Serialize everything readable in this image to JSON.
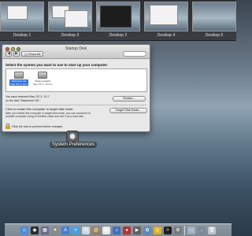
{
  "spaces": [
    {
      "label": "Desktop 1"
    },
    {
      "label": "Desktop 3"
    },
    {
      "label": "Desktop 2"
    },
    {
      "label": "Desktop 4"
    },
    {
      "label": "Desktop 5"
    }
  ],
  "window": {
    "title": "Startup Disk",
    "nav_back": "◀",
    "nav_forward": "▶",
    "show_all_label": "Show All",
    "prompt": "Select the system you want to use to start up your computer",
    "disks": [
      {
        "name": "Macintosh HD",
        "os": "Mac OS X, 10.7",
        "selected": true
      },
      {
        "name": "Snow Leopard",
        "os": "Mac OS X, 10.6.8",
        "selected": false
      }
    ],
    "status_line1": "You have selected Mac OS X, 10.7",
    "status_line2": "on the disk \"Macintosh HD.\"",
    "restart_label": "Restart...",
    "tdm_title": "Click to restart this computer in target disk mode",
    "tdm_desc": "After you restart this computer in target disk mode, you can connect it to another computer using a FireWire cable and use it as a hard disk.",
    "tdm_button_label": "Target Disk Mode...",
    "lock_text": "Click the lock to prevent further changes."
  },
  "app_label": "System Preferences",
  "dock": {
    "items": [
      {
        "icon": "finder-icon",
        "color": "#4a8de0",
        "glyph": "☺"
      },
      {
        "icon": "dashboard-icon",
        "color": "#2a2a2a",
        "glyph": "◉"
      },
      {
        "icon": "mission-control-icon",
        "color": "#6a6a8a",
        "glyph": "▦"
      },
      {
        "icon": "launchpad-icon",
        "color": "#8a8a8a",
        "glyph": "✦"
      },
      {
        "icon": "app-store-icon",
        "color": "#3d82d8",
        "glyph": "A"
      },
      {
        "icon": "safari-icon",
        "color": "#4aa0e8",
        "glyph": "✧"
      },
      {
        "icon": "mail-icon",
        "color": "#cfd6df",
        "glyph": "✉"
      },
      {
        "icon": "contacts-icon",
        "color": "#a08050",
        "glyph": "@"
      },
      {
        "icon": "ical-icon",
        "color": "#e8e8e8",
        "glyph": "▤"
      },
      {
        "icon": "itunes-icon",
        "color": "#3a6fc0",
        "glyph": "♫"
      },
      {
        "icon": "photo-booth-icon",
        "color": "#b83030",
        "glyph": "●"
      },
      {
        "icon": "facetime-icon",
        "color": "#606060",
        "glyph": "▶"
      },
      {
        "icon": "iphoto-icon",
        "color": "#5a8ab8",
        "glyph": "✿"
      },
      {
        "icon": "chrome-icon",
        "color": "#e0b020",
        "glyph": "◎"
      },
      {
        "icon": "terminal-icon",
        "color": "#202020",
        "glyph": ">"
      },
      {
        "icon": "system-preferences-icon",
        "color": "#7a7a7a",
        "glyph": "⚙"
      },
      {
        "icon": "finder-window-icon",
        "color": "#a0b0c0",
        "glyph": "▭"
      },
      {
        "icon": "downloads-icon",
        "color": "#7a8a9a",
        "glyph": "↓"
      },
      {
        "icon": "trash-icon",
        "color": "#c0c4c8",
        "glyph": "🗑"
      }
    ]
  }
}
